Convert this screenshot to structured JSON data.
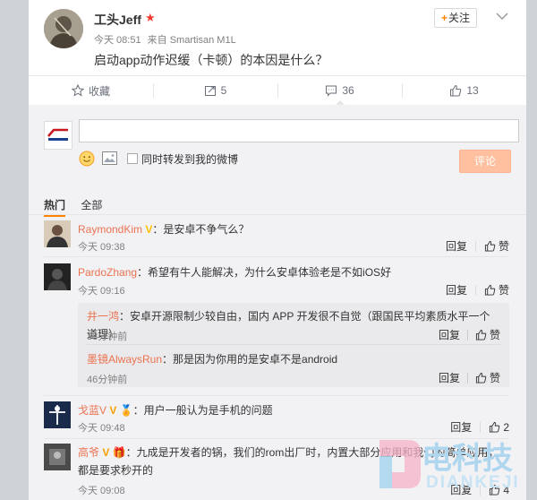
{
  "post": {
    "author": "工头Jeff",
    "time": "今天 08:51",
    "source": "来自 Smartisan M1L",
    "text": "启动app动作迟缓（卡顿）的本因是什么？",
    "follow_label": "关注"
  },
  "actions": {
    "favorite": "收藏",
    "repost": "5",
    "comment": "36",
    "like": "13"
  },
  "composer": {
    "placeholder": "",
    "forward_label": "同时转发到我的微博",
    "submit_label": "评论"
  },
  "tabs": [
    "热门",
    "全部"
  ],
  "comments": [
    {
      "name": "RaymondKim",
      "text": "：是安卓不争气么？",
      "time": "今天 09:38",
      "reply_label": "回复",
      "like_label": "赞"
    },
    {
      "name": "PardoZhang",
      "text": "：希望有牛人能解决，为什么安卓体验老是不如iOS好",
      "time": "今天 09:16",
      "reply_label": "回复",
      "like_label": "赞",
      "replies": [
        {
          "name": "井一鸿",
          "text": "：安卓开源限制少较自由，国内 APP 开发很不自觉（跟国民平均素质水平一个道理）",
          "time": "33分钟前",
          "reply_label": "回复",
          "like_label": "赞"
        },
        {
          "name": "墨镜AlwaysRun",
          "text": "：那是因为你用的是安卓不是android",
          "time": "46分钟前",
          "reply_label": "回复",
          "like_label": "赞"
        }
      ]
    },
    {
      "name": "戈蓝V",
      "text": "：用户一般认为是手机的问题",
      "time": "今天 09:48",
      "reply_label": "回复",
      "like_count": "2"
    },
    {
      "name": "高爷",
      "text": "：九成是开发者的锅，我们的rom出厂时，内置大部分应用和我们的简单应用，都是要求秒开的",
      "time": "今天 09:08",
      "reply_label": "回复",
      "like_count": "4"
    }
  ],
  "watermark": {
    "cn": "电科技",
    "en": "DIANKEJI"
  },
  "colors": {
    "accent": "#ff8200",
    "name_link": "#eb7350",
    "submit_bg": "#ffc09f",
    "page_bg": "#cdd3d6"
  }
}
